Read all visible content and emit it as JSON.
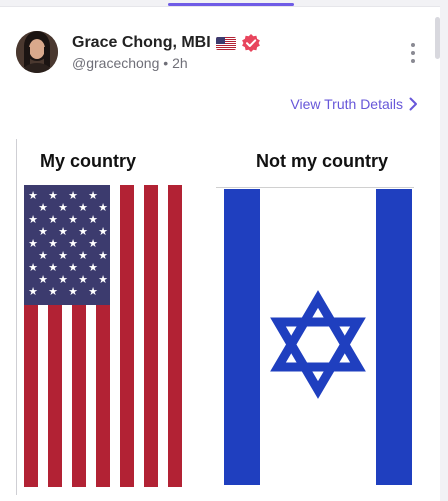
{
  "post": {
    "author": {
      "display_name": "Grace Chong, MBI",
      "flag_icon": "us-flag-icon",
      "verified_icon": "verified-badge-icon",
      "handle": "@gracechong",
      "separator": "•",
      "time_ago": "2h"
    },
    "menu_icon": "more-vertical-icon",
    "view_details_label": "View Truth Details",
    "image": {
      "caption_left": "My country",
      "caption_right": "Not my country"
    }
  },
  "colors": {
    "accent": "#6757d9",
    "verified": "#e8455d",
    "usa_red": "#b22234",
    "usa_blue": "#3c3b6e",
    "israel_blue": "#1f3fbf"
  }
}
